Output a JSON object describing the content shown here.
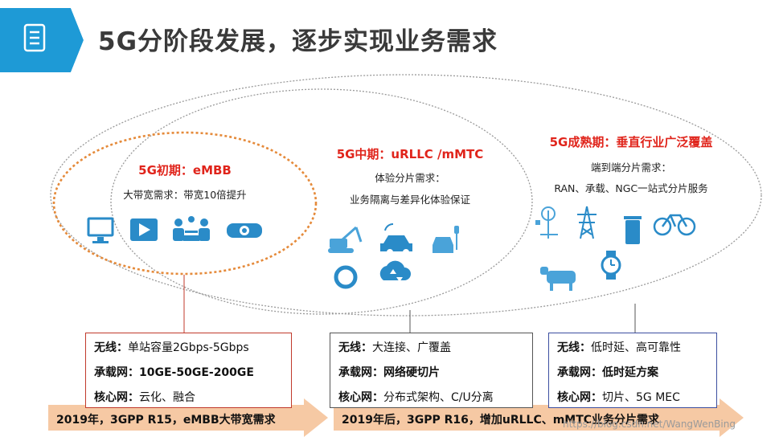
{
  "title": "5G分阶段发展，逐步实现业务需求",
  "phases": [
    {
      "title": "5G初期：eMBB",
      "subtitle": "大带宽需求：带宽10倍提升"
    },
    {
      "title": "5G中期：uRLLC /mMTC",
      "subtitle": "体验分片需求：",
      "subtitle2": "业务隔离与差异化体验保证"
    },
    {
      "title": "5G成熟期：垂直行业广泛覆盖",
      "subtitle": "端到端分片需求：",
      "subtitle2": "RAN、承载、NGC一站式分片服务"
    }
  ],
  "boxes": [
    {
      "rows": [
        {
          "label": "无线：",
          "value": "单站容量2Gbps-5Gbps"
        },
        {
          "label": "承载网：",
          "value": "10GE-50GE-200GE"
        },
        {
          "label": "核心网：",
          "value": "云化、融合"
        }
      ]
    },
    {
      "rows": [
        {
          "label": "无线：",
          "value": "大连接、广覆盖"
        },
        {
          "label": "承载网：",
          "value": "网络硬切片"
        },
        {
          "label": "核心网：",
          "value": "分布式架构、C/U分离"
        }
      ]
    },
    {
      "rows": [
        {
          "label": "无线：",
          "value": "低时延、高可靠性"
        },
        {
          "label": "承载网：",
          "value": "低时延方案"
        },
        {
          "label": "核心网：",
          "value": "切片、5G MEC"
        }
      ]
    }
  ],
  "arrows": [
    {
      "label": "2019年，3GPP R15，eMBB大带宽需求"
    },
    {
      "label": "2019年后，3GPP R16，增加uRLLC、mMTC业务分片需求"
    }
  ],
  "watermark": "https://blog.csdn.net/WangWenBing",
  "colors": {
    "accent_blue": "#1e9ad6",
    "red": "#e0241b",
    "orange": "#e58a3a",
    "arrow": "#f6c9a4",
    "icon_blue": "#2a8bc8"
  }
}
